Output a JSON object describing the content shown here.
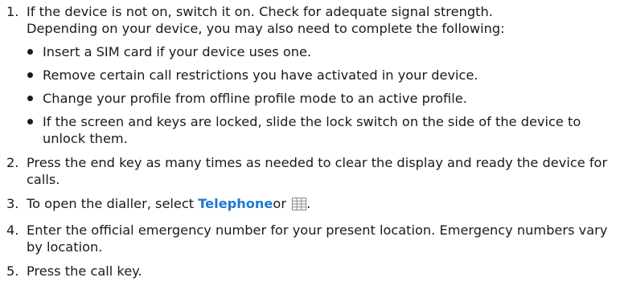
{
  "steps": [
    {
      "number": "1.",
      "line1": "If the device is not on, switch it on. Check for adequate signal strength.",
      "line2": "Depending on your device, you may also need to complete the following:",
      "subs": [
        "Insert a SIM card if your device uses one.",
        "Remove certain call restrictions you have activated in your device.",
        "Change your profile from offline profile mode to an active profile.",
        "If the screen and keys are locked, slide the lock switch on the side of the device to unlock them."
      ]
    },
    {
      "number": "2.",
      "text": "Press the end key as many times as needed to clear the display and ready the device for calls."
    },
    {
      "number": "3.",
      "prefix": "To open the dialler, select ",
      "link": "Telephone",
      "middle": "or ",
      "icon": "dialpad-grid-icon",
      "suffix": "."
    },
    {
      "number": "4.",
      "text": "Enter the official emergency number for your present location. Emergency numbers vary by location."
    },
    {
      "number": "5.",
      "text": "Press the call key."
    }
  ],
  "colors": {
    "link": "#1e78d2",
    "text": "#1a1a1a",
    "icon": "#8a8a8a"
  }
}
